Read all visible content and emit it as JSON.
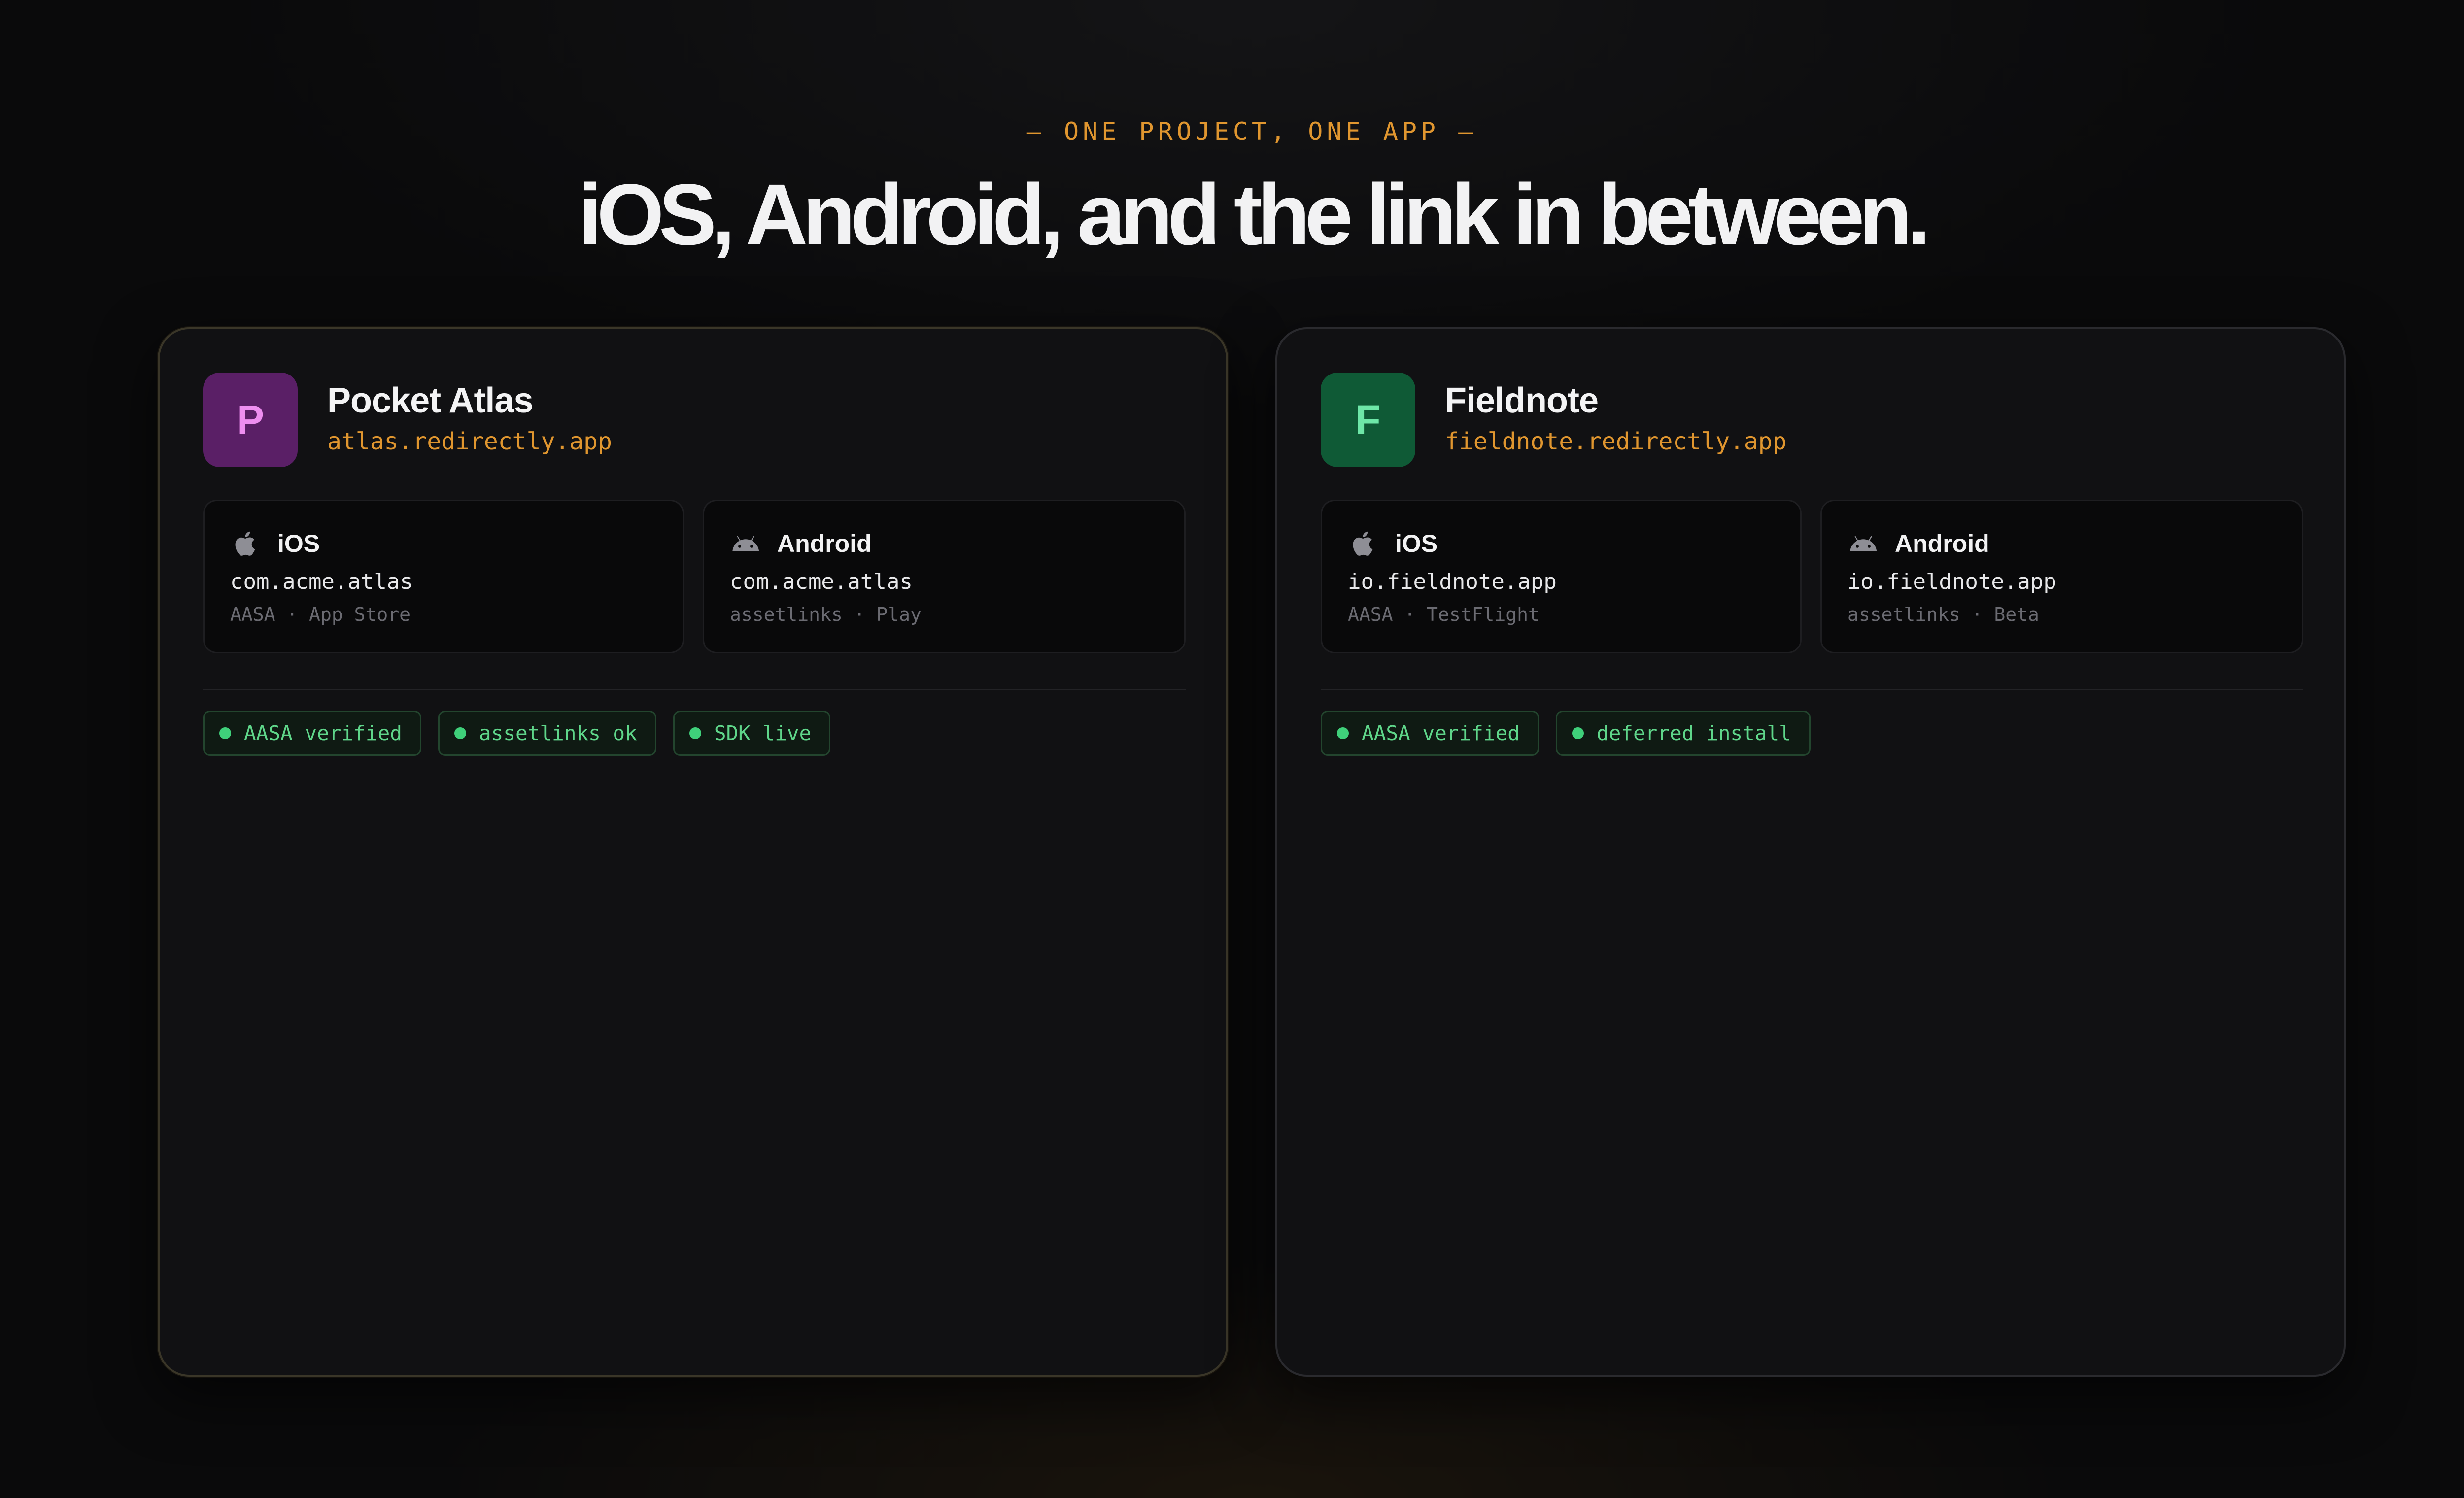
{
  "eyebrow": "— ONE PROJECT, ONE APP —",
  "headline": "iOS, Android, and the link in between.",
  "colors": {
    "accent": "#e0962f",
    "background": "#0a0a0b",
    "card": "#111113",
    "badge_text": "#5fd68a",
    "badge_dot": "#3fd07a"
  },
  "projects": [
    {
      "icon_letter": "P",
      "icon_bg": "#5a1f66",
      "icon_fg": "#ee8ef0",
      "name": "Pocket Atlas",
      "domain": "atlas.redirectly.app",
      "ios": {
        "icon": "apple-icon",
        "label": "iOS",
        "bundle": "com.acme.atlas",
        "meta": "AASA · App Store"
      },
      "android": {
        "icon": "android-icon",
        "label": "Android",
        "bundle": "com.acme.atlas",
        "meta": "assetlinks · Play"
      },
      "badges": [
        "AASA verified",
        "assetlinks ok",
        "SDK live"
      ]
    },
    {
      "icon_letter": "F",
      "icon_bg": "#0f5a36",
      "icon_fg": "#6ee7a8",
      "name": "Fieldnote",
      "domain": "fieldnote.redirectly.app",
      "ios": {
        "icon": "apple-icon",
        "label": "iOS",
        "bundle": "io.fieldnote.app",
        "meta": "AASA · TestFlight"
      },
      "android": {
        "icon": "android-icon",
        "label": "Android",
        "bundle": "io.fieldnote.app",
        "meta": "assetlinks · Beta"
      },
      "badges": [
        "AASA verified",
        "deferred install"
      ]
    }
  ]
}
